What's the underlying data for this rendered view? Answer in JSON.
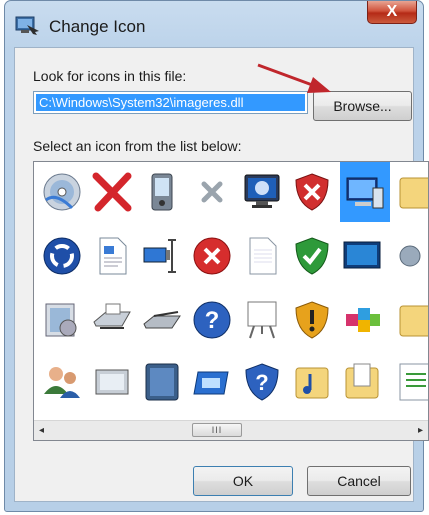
{
  "window": {
    "title": "Change Icon",
    "close_label": "X"
  },
  "file_section": {
    "label": "Look for icons in this file:",
    "path_value": "C:\\Windows\\System32\\imageres.dll",
    "browse_label": "Browse..."
  },
  "list_section": {
    "label": "Select an icon from the list below:",
    "icons": [
      [
        "cd-disc-icon",
        "red-x-icon",
        "pda-device-icon",
        "gray-x-icon",
        "monitor-icon",
        "security-shield-red-icon",
        "computer-selected-icon",
        "folder-partial-icon"
      ],
      [
        "circular-arrows-icon",
        "document-icon",
        "network-connector-icon",
        "error-red-circle-icon",
        "blank-page-icon",
        "security-shield-green-icon",
        "display-screen-icon",
        "gear-partial-icon"
      ],
      [
        "media-library-icon",
        "printer-icon",
        "scanner-icon",
        "help-question-icon",
        "projector-screen-icon",
        "security-shield-warning-icon",
        "apps-cube-icon",
        "folder-partial-icon"
      ],
      [
        "users-icon",
        "device-panel-icon",
        "tablet-icon",
        "card-reader-icon",
        "help-shield-icon",
        "music-folder-icon",
        "document-folder-icon",
        "document-partial-icon"
      ]
    ],
    "scrollbar": {
      "thumb_grip": "III",
      "left_arrow": "◂",
      "right_arrow": "▸"
    }
  },
  "buttons": {
    "ok_label": "OK",
    "cancel_label": "Cancel"
  },
  "annotation": {
    "arrow_color": "#c0262c"
  }
}
